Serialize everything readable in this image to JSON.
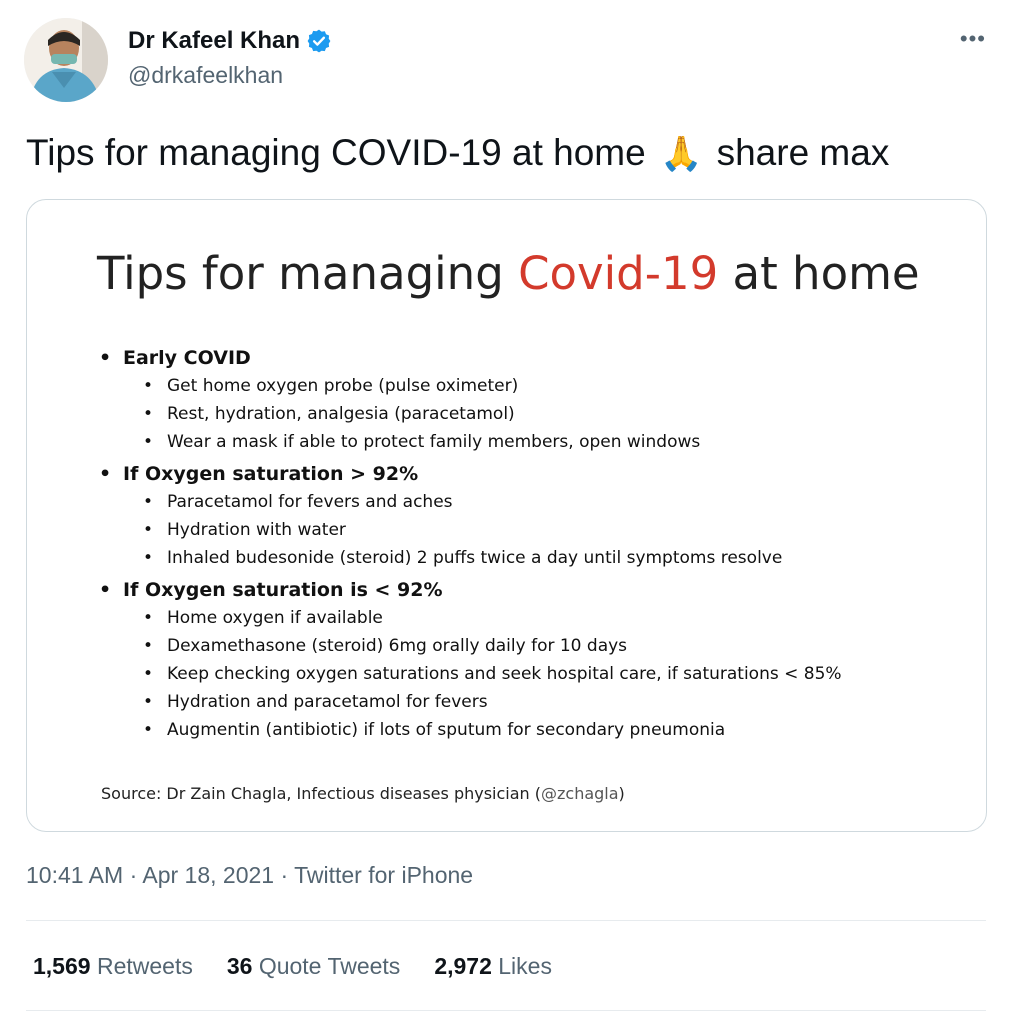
{
  "author": {
    "display_name": "Dr Kafeel Khan",
    "handle": "@drkafeelkhan",
    "verified_icon": "verified-badge-icon",
    "more_icon": "more-dots-icon",
    "more_label": "•••"
  },
  "tweet": {
    "text_before": "Tips for managing COVID-19 at home",
    "emoji": "🙏",
    "text_after": "share max"
  },
  "slide": {
    "title_part1": "Tips for managing ",
    "title_highlight": "Covid-19",
    "title_part2": " at home",
    "highlight_color": "#d33a2c",
    "sections": [
      {
        "heading": "Early COVID",
        "items": [
          "Get home oxygen probe (pulse oximeter)",
          "Rest, hydration, analgesia (paracetamol)",
          "Wear a mask if able to protect family members, open windows"
        ]
      },
      {
        "heading": "If Oxygen saturation > 92%",
        "items": [
          "Paracetamol for fevers and aches",
          "Hydration with water",
          "Inhaled budesonide (steroid) 2 puffs twice a day until symptoms resolve"
        ]
      },
      {
        "heading": "If Oxygen saturation is < 92%",
        "items": [
          "Home oxygen if available",
          "Dexamethasone (steroid) 6mg orally daily for 10 days",
          "Keep checking oxygen saturations and seek hospital care, if saturations < 85%",
          "Hydration and paracetamol for fevers",
          "Augmentin (antibiotic) if lots of sputum for secondary pneumonia"
        ]
      }
    ],
    "source_text": "Source: Dr Zain Chagla, Infectious diseases physician (",
    "source_handle": "@zchagla",
    "source_close": ")"
  },
  "meta": {
    "time": "10:41 AM",
    "sep1": " · ",
    "date": "Apr 18, 2021",
    "sep2": " · ",
    "client": "Twitter for iPhone"
  },
  "stats": {
    "retweets_count": "1,569",
    "retweets_label": "Retweets",
    "quotes_count": "36",
    "quotes_label": "Quote Tweets",
    "likes_count": "2,972",
    "likes_label": "Likes"
  }
}
